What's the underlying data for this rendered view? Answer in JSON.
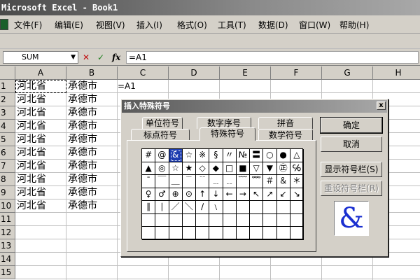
{
  "window": {
    "title": "Microsoft Excel - Book1"
  },
  "menu": {
    "items": [
      "文件(F)",
      "编辑(E)",
      "视图(V)",
      "插入(I)",
      "格式(O)",
      "工具(T)",
      "数据(D)",
      "窗口(W)",
      "帮助(H)"
    ]
  },
  "formula_bar": {
    "name_box": "SUM",
    "cancel_glyph": "✕",
    "enter_glyph": "✓",
    "fx_label": "fx",
    "formula": "=A1"
  },
  "sheet": {
    "columns": [
      "A",
      "B",
      "C",
      "D",
      "E",
      "F",
      "G",
      "H"
    ],
    "rows": [
      "1",
      "2",
      "3",
      "4",
      "5",
      "6",
      "7",
      "8",
      "9",
      "10",
      "11",
      "12",
      "13",
      "14",
      "15"
    ],
    "col_a": [
      "河北省",
      "河北省",
      "河北省",
      "河北省",
      "河北省",
      "河北省",
      "河北省",
      "河北省",
      "河北省",
      "河北省"
    ],
    "col_b": [
      "承德市",
      "承德市",
      "承德市",
      "承德市",
      "承德市",
      "承德市",
      "承德市",
      "承德市",
      "承德市",
      "承德市"
    ],
    "c1": "=A1"
  },
  "dialog": {
    "title": "插入特殊符号",
    "close_glyph": "x",
    "tabs_back": [
      "单位符号",
      "数字序号",
      "拼音"
    ],
    "tabs_front": [
      "标点符号",
      "特殊符号",
      "数学符号"
    ],
    "active_tab": "特殊符号",
    "symbols": [
      "#",
      "@",
      "&",
      "☆",
      "※",
      "§",
      "〃",
      "№",
      "〓",
      "○",
      "●",
      "△",
      "▲",
      "◎",
      "☆",
      "★",
      "◇",
      "◆",
      "□",
      "■",
      "▽",
      "▼",
      "㊣",
      "℅",
      "ˉ",
      "￣",
      "＿",
      "﹉",
      "﹊",
      "﹍",
      "﹎",
      "﹋",
      "﹌",
      "＃",
      "＆",
      "＊",
      "♀",
      "♂",
      "⊕",
      "⊙",
      "↑",
      "↓",
      "←",
      "→",
      "↖",
      "↗",
      "↙",
      "↘",
      "∥",
      "∣",
      "／",
      "＼",
      "∕",
      "﹨",
      "",
      "",
      "",
      "",
      "",
      "",
      "",
      "",
      "",
      "",
      "",
      "",
      "",
      "",
      "",
      "",
      "",
      "",
      "",
      "",
      "",
      "",
      "",
      "",
      "",
      "",
      "",
      "",
      "",
      ""
    ],
    "selected_index": 2,
    "buttons": {
      "ok": "确定",
      "cancel": "取消",
      "show_bar": "显示符号栏(S)",
      "reset_bar": "重设符号栏(R)"
    },
    "preview_symbol": "&"
  },
  "colors": {
    "selection": "#1c3cb0",
    "preview_glyph": "#1a2fd0",
    "cancel_x": "#c01010",
    "enter_check": "#208020"
  }
}
